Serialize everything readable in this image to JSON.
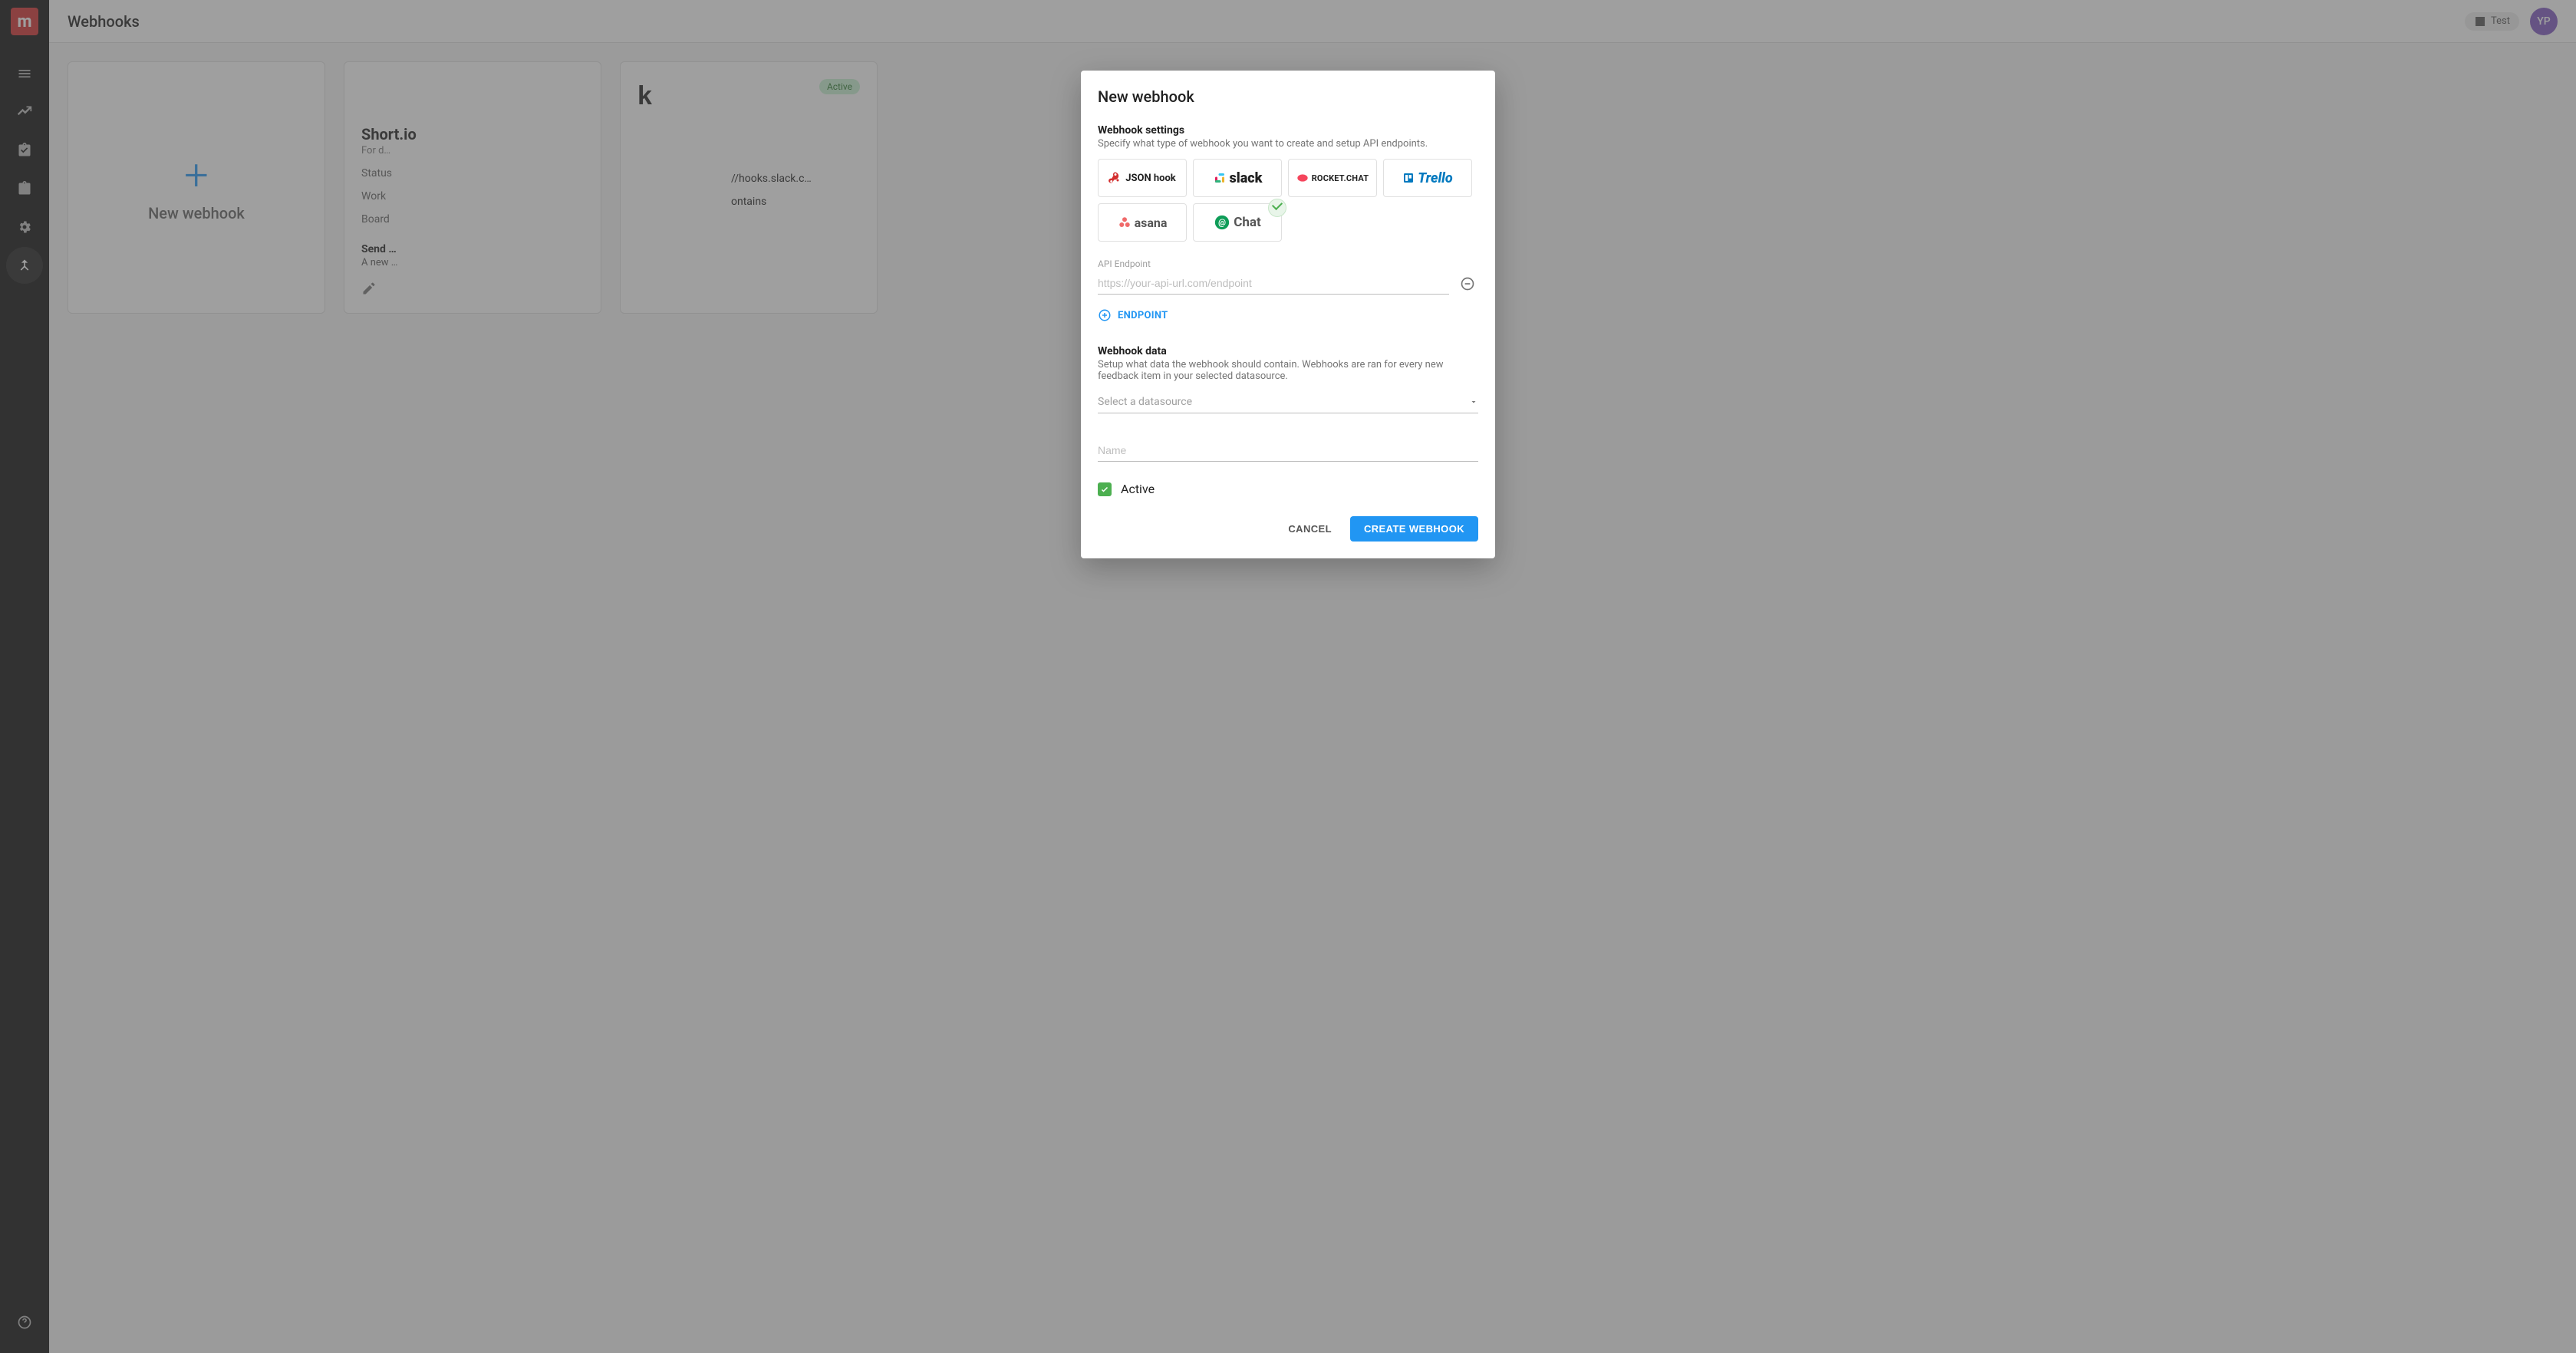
{
  "topbar": {
    "title": "Webhooks",
    "chip": {
      "icon": "poll",
      "text": "Test"
    },
    "avatar": "YP"
  },
  "sidebar": {
    "logo": "m",
    "items": [
      {
        "name": "menu-icon"
      },
      {
        "name": "trend-icon"
      },
      {
        "name": "assignment-icon"
      },
      {
        "name": "clipboard-icon"
      },
      {
        "name": "gear-icon"
      },
      {
        "name": "merge-icon",
        "active": true
      }
    ],
    "help": "help-icon"
  },
  "cards": {
    "new": {
      "plus": "+",
      "label": "New webhook"
    },
    "card_short_io": {
      "brand": "",
      "title": "Short.io",
      "subtitle": "For d…",
      "status": {
        "label": "Status",
        "value": ""
      },
      "work": {
        "label": "Work",
        "value": ""
      },
      "board": {
        "label": "Board",
        "value": ""
      },
      "send_title": "Send …",
      "send_desc": "A new …",
      "status_pill": ""
    },
    "card_slack": {
      "brand": "k",
      "title": "",
      "subtitle": "",
      "status": {
        "label": "",
        "value": ""
      },
      "url_fragment": "//hooks.slack.c…",
      "contains": "ontains",
      "status_pill": "Active"
    }
  },
  "modal": {
    "title": "New webhook",
    "settings": {
      "title": "Webhook settings",
      "subtitle": "Specify what type of webhook you want to create and setup API endpoints.",
      "types": [
        {
          "id": "json",
          "label": "JSON hook"
        },
        {
          "id": "slack",
          "label": "slack"
        },
        {
          "id": "rocket",
          "label": "ROCKET.CHAT"
        },
        {
          "id": "trello",
          "label": "Trello"
        },
        {
          "id": "asana",
          "label": "asana"
        },
        {
          "id": "chat",
          "label": "Chat",
          "selected": true
        }
      ],
      "endpoint": {
        "label": "API Endpoint",
        "placeholder": "https://your-api-url.com/endpoint",
        "value": ""
      },
      "add_endpoint": "ENDPOINT"
    },
    "data": {
      "title": "Webhook data",
      "subtitle": "Setup what data the webhook should contain. Webhooks are ran for every new feedback item in your selected datasource.",
      "datasource_placeholder": "Select a datasource",
      "name_placeholder": "Name",
      "active_label": "Active",
      "active_checked": true
    },
    "actions": {
      "cancel": "CANCEL",
      "create": "CREATE WEBHOOK"
    }
  }
}
